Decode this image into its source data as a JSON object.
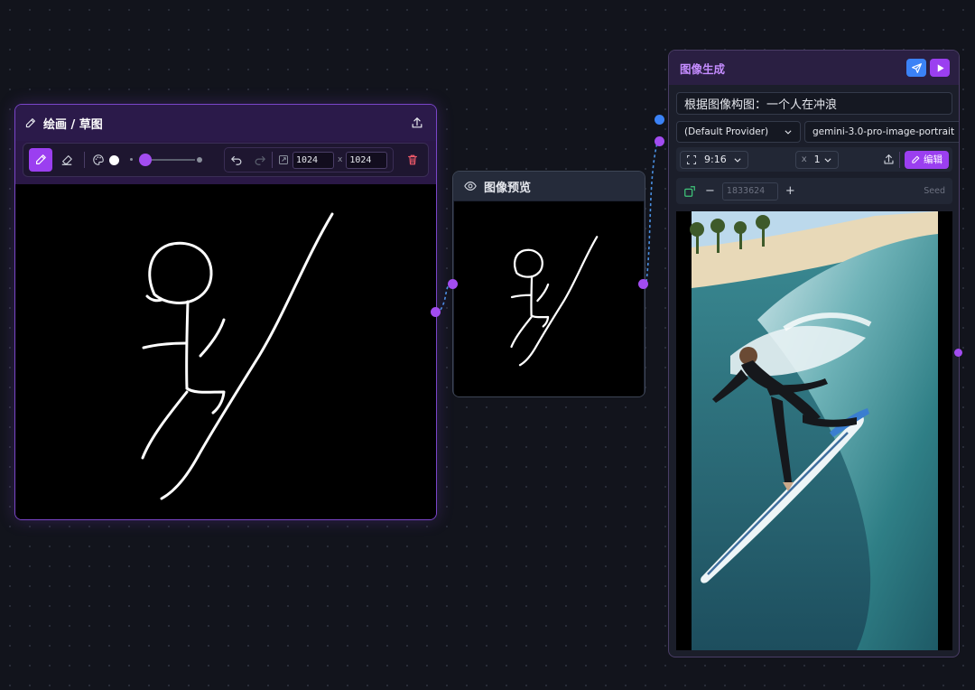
{
  "draw_node": {
    "title": "绘画 / 草图",
    "tools": {
      "brush": "pencil-icon",
      "eraser": "eraser-icon",
      "palette": "palette-icon"
    },
    "brush_color": "#ffffff",
    "brush_size_fraction": 0.12,
    "canvas_width": "1024",
    "canvas_height": "1024",
    "dim_separator": "x"
  },
  "preview_node": {
    "title": "图像预览"
  },
  "gen_node": {
    "title": "图像生成",
    "prompt": "根据图像构图：一个人在冲浪",
    "provider": "(Default Provider)",
    "model": "gemini-3.0-pro-image-portrait",
    "aspect_ratio": "9:16",
    "count_prefix": "x",
    "count": "1",
    "edit_label": "编辑",
    "seed_placeholder": "1833624",
    "seed_label": "Seed",
    "minus": "−",
    "plus": "+"
  },
  "colors": {
    "accent": "#9b3ff0",
    "port_purple": "#a24cf0",
    "port_blue": "#3b82f6",
    "canvas_bg": "#12141c",
    "connector": "#4a90e2"
  }
}
